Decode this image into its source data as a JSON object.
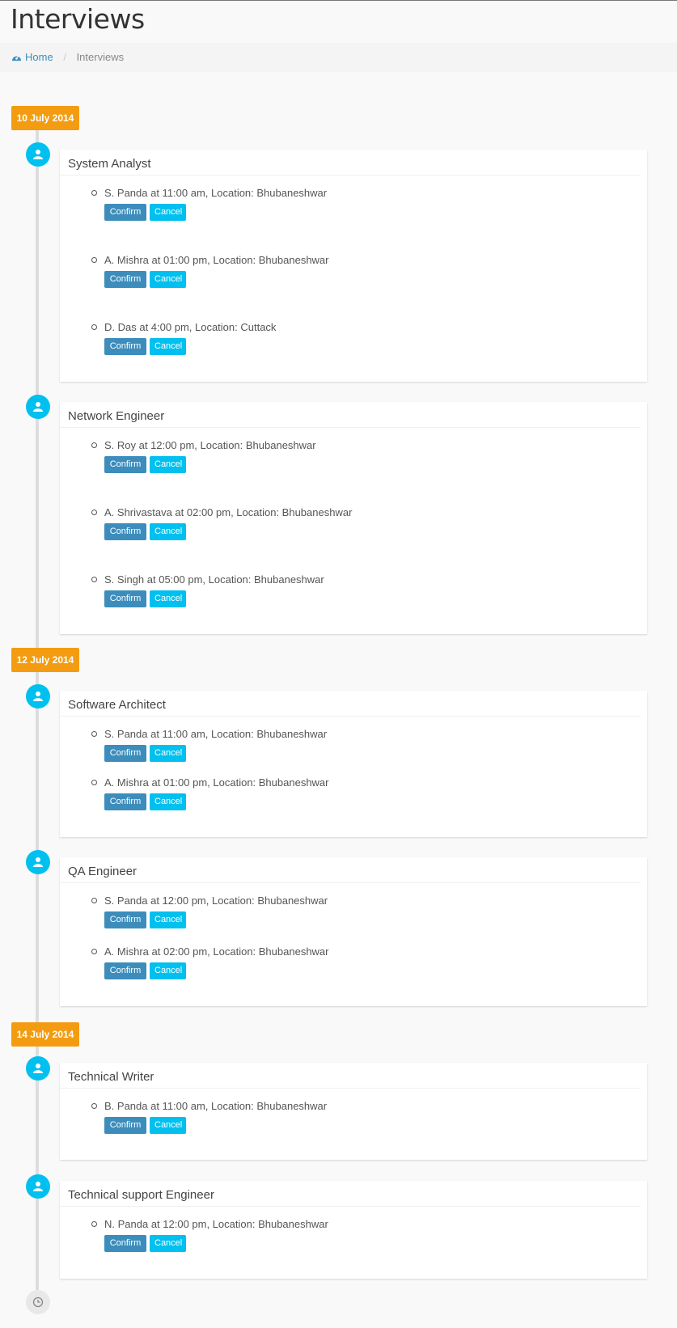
{
  "page": {
    "title": "Interviews"
  },
  "breadcrumb": {
    "home": "Home",
    "current": "Interviews"
  },
  "buttons": {
    "confirm": "Confirm",
    "cancel": "Cancel"
  },
  "colors": {
    "date_label": "#f39c12",
    "icon": "#00c0ef",
    "confirm": "#3c8dbc",
    "cancel": "#00c0ef"
  },
  "timeline": [
    {
      "date": "10 July 2014",
      "jobs": [
        {
          "title": "System Analyst",
          "entries": [
            "S. Panda at 11:00 am, Location: Bhubaneshwar",
            "A. Mishra at 01:00 pm, Location: Bhubaneshwar",
            "D. Das at 4:00 pm, Location: Cuttack"
          ]
        },
        {
          "title": "Network Engineer",
          "entries": [
            "S. Roy at 12:00 pm, Location: Bhubaneshwar",
            "A. Shrivastava at 02:00 pm, Location: Bhubaneshwar",
            "S. Singh at 05:00 pm, Location: Bhubaneshwar"
          ]
        }
      ]
    },
    {
      "date": "12 July 2014",
      "jobs": [
        {
          "title": "Software Architect",
          "entries": [
            "S. Panda at 11:00 am, Location: Bhubaneshwar",
            "A. Mishra at 01:00 pm, Location: Bhubaneshwar"
          ]
        },
        {
          "title": "QA Engineer",
          "entries": [
            "S. Panda at 12:00 pm, Location: Bhubaneshwar",
            "A. Mishra at 02:00 pm, Location: Bhubaneshwar"
          ]
        }
      ]
    },
    {
      "date": "14 July 2014",
      "jobs": [
        {
          "title": "Technical Writer",
          "entries": [
            "B. Panda at 11:00 am, Location: Bhubaneshwar"
          ]
        },
        {
          "title": "Technical support Engineer",
          "entries": [
            "N. Panda at 12:00 pm, Location: Bhubaneshwar"
          ]
        }
      ]
    }
  ]
}
